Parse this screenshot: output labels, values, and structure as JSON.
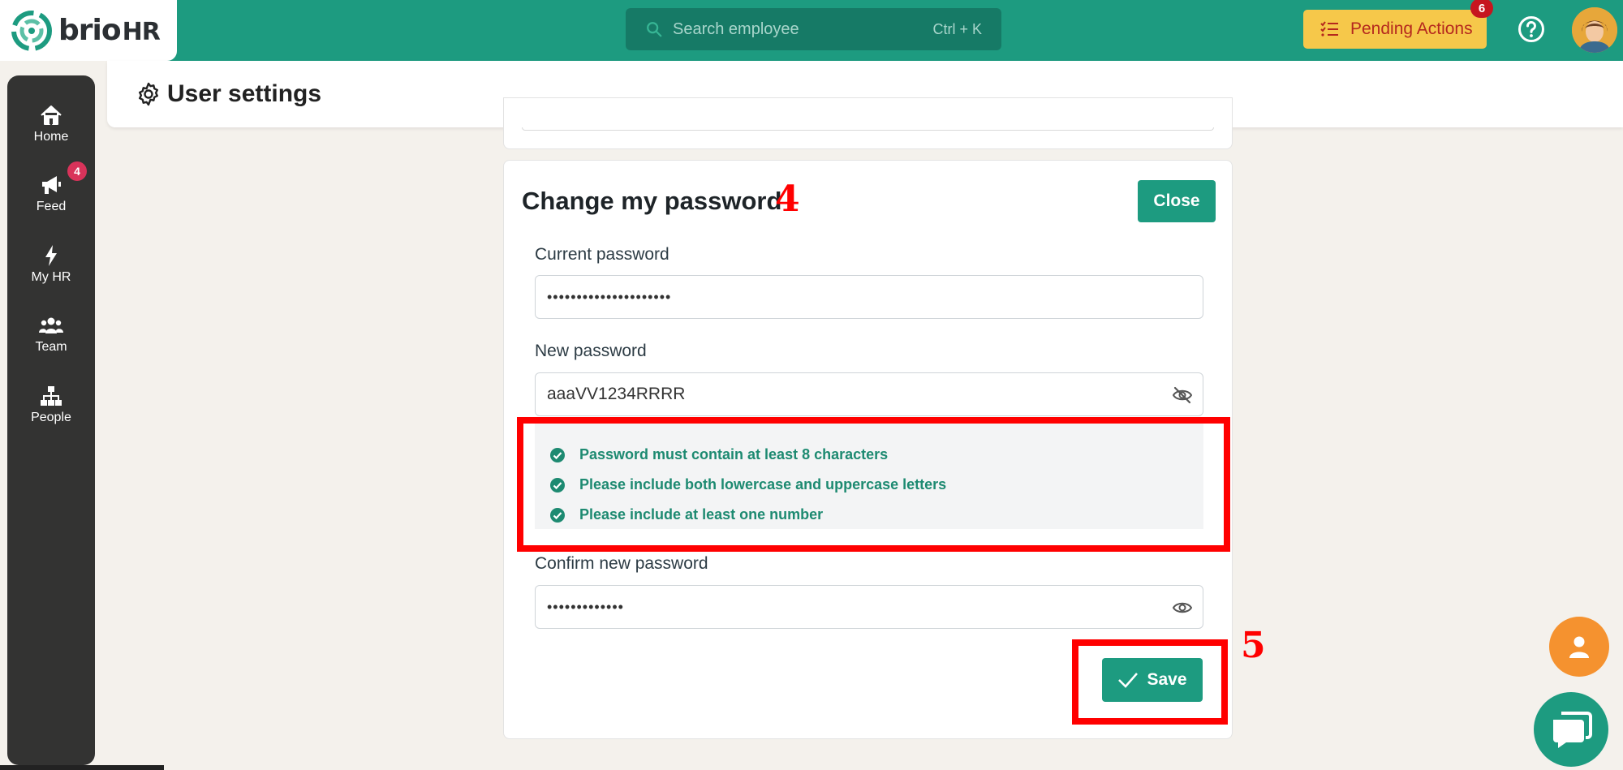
{
  "brand": {
    "name": "brio",
    "suffix": "HR",
    "color": "#1d9b80"
  },
  "topbar": {
    "search_placeholder": "Search employee",
    "search_shortcut": "Ctrl + K",
    "pending_label": "Pending Actions",
    "pending_count": "6"
  },
  "sidebar": {
    "items": [
      {
        "label": "Home",
        "icon": "home-icon"
      },
      {
        "label": "Feed",
        "icon": "megaphone-icon",
        "badge": "4"
      },
      {
        "label": "My HR",
        "icon": "bolt-icon"
      },
      {
        "label": "Team",
        "icon": "team-icon"
      },
      {
        "label": "People",
        "icon": "org-chart-icon"
      }
    ]
  },
  "header": {
    "title": "User settings",
    "icon": "gear-icon"
  },
  "password_card": {
    "title": "Change my password",
    "close_label": "Close",
    "current_label": "Current password",
    "current_value": "•••••••••••••••••••••",
    "new_label": "New password",
    "new_value": "aaaVV1234RRRR",
    "rules": [
      "Password must contain at least 8 characters",
      "Please include both lowercase and uppercase letters",
      "Please include at least one number"
    ],
    "confirm_label": "Confirm new password",
    "confirm_value": "•••••••••••••",
    "save_label": "Save"
  },
  "annotations": {
    "step_a": "4",
    "step_b": "5",
    "color": "#ff0000"
  }
}
